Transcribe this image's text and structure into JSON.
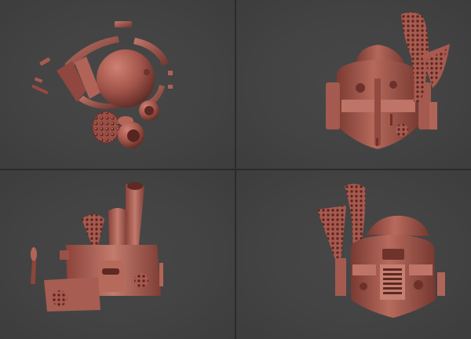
{
  "app": {
    "layout": "quad-viewport",
    "background_color": "#444444",
    "divider_color": "#2b2b2b",
    "model_color": "#a6574e"
  },
  "viewports": [
    {
      "id": "tl",
      "content": "exploded-helmet-parts"
    },
    {
      "id": "tr",
      "content": "helmet-back-view"
    },
    {
      "id": "bl",
      "content": "helmet-side-view"
    },
    {
      "id": "br",
      "content": "helmet-front-view"
    }
  ]
}
